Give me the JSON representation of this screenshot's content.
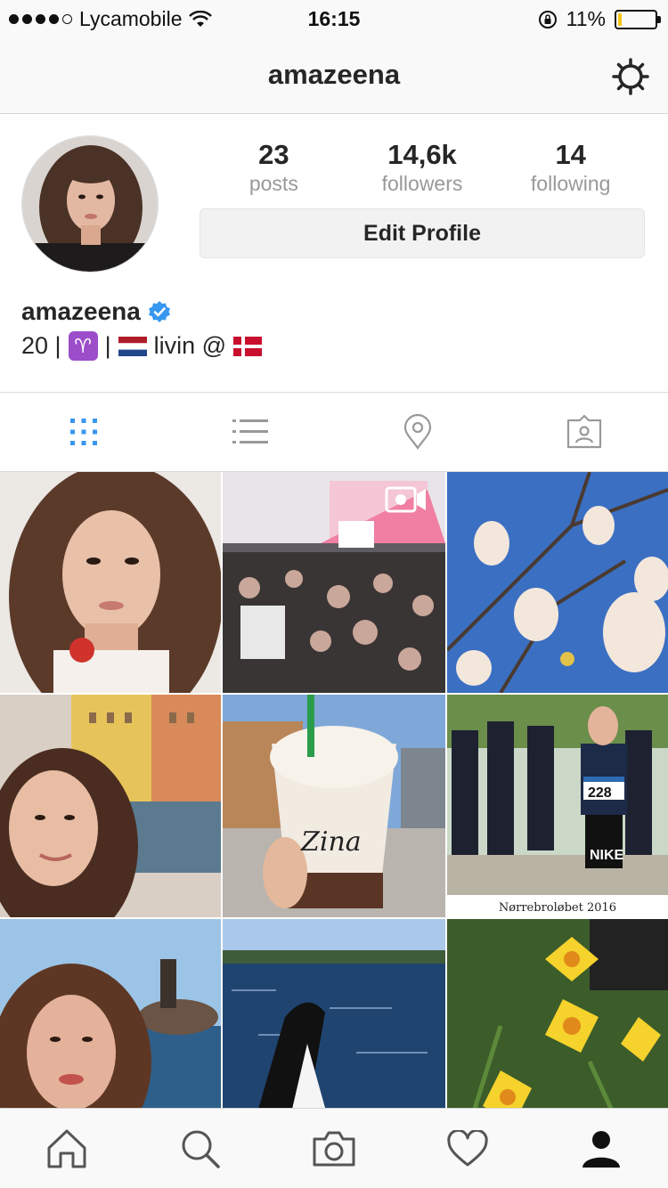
{
  "status_bar": {
    "carrier": "Lycamobile",
    "time": "16:15",
    "battery_percent": "11%",
    "battery_level": 0.11
  },
  "header": {
    "title": "amazeena"
  },
  "profile": {
    "stats": [
      {
        "value": "23",
        "label": "posts"
      },
      {
        "value": "14,6k",
        "label": "followers"
      },
      {
        "value": "14",
        "label": "following"
      }
    ],
    "edit_button": "Edit Profile",
    "name": "amazeena",
    "bio_age": "20 |",
    "bio_sep": "|",
    "bio_livin": "livin @",
    "aries_glyph": "♈"
  },
  "tabs": [
    {
      "name": "grid-view",
      "icon": "grid-icon",
      "active": true
    },
    {
      "name": "list-view",
      "icon": "list-icon",
      "active": false
    },
    {
      "name": "places",
      "icon": "location-pin-icon",
      "active": false
    },
    {
      "name": "tagged",
      "icon": "tagged-photos-icon",
      "active": false
    }
  ],
  "grid_posts": [
    {
      "type": "photo",
      "caption_overlay": ""
    },
    {
      "type": "video",
      "caption_overlay": ""
    },
    {
      "type": "photo",
      "caption_overlay": ""
    },
    {
      "type": "photo",
      "caption_overlay": ""
    },
    {
      "type": "photo",
      "caption_overlay": "Zina"
    },
    {
      "type": "photo",
      "caption_overlay": "Nørrebroløbet 2016",
      "bib": "228",
      "shirt": "NIKE"
    },
    {
      "type": "photo",
      "caption_overlay": ""
    },
    {
      "type": "photo",
      "caption_overlay": ""
    },
    {
      "type": "photo",
      "caption_overlay": ""
    }
  ],
  "colors": {
    "accent_blue": "#3897f0",
    "text_primary": "#262626",
    "text_secondary": "#999999",
    "battery_yellow": "#f5c518"
  },
  "tab_bar": [
    {
      "name": "home",
      "icon": "home-icon"
    },
    {
      "name": "search",
      "icon": "search-icon"
    },
    {
      "name": "camera",
      "icon": "camera-icon"
    },
    {
      "name": "activity",
      "icon": "heart-icon"
    },
    {
      "name": "profile",
      "icon": "profile-icon",
      "active": true
    }
  ]
}
